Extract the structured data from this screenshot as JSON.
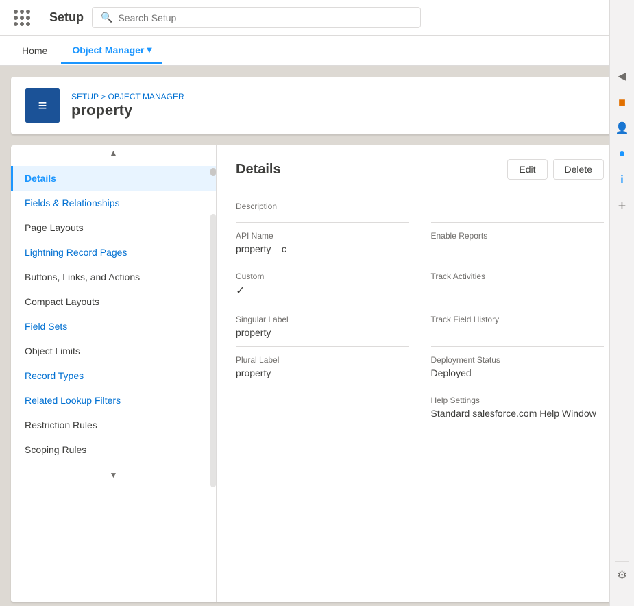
{
  "topBar": {
    "searchPlaceholder": "Search Setup"
  },
  "navBar": {
    "home": "Home",
    "objectManager": "Object Manager",
    "setupLabel": "Setup"
  },
  "breadcrumb": {
    "setup": "SETUP",
    "separator": " > ",
    "objectManager": "OBJECT MANAGER"
  },
  "objectHeader": {
    "title": "property",
    "iconLabel": "layers"
  },
  "leftNav": {
    "items": [
      {
        "id": "details",
        "label": "Details",
        "active": true,
        "link": false
      },
      {
        "id": "fields-relationships",
        "label": "Fields & Relationships",
        "active": false,
        "link": true
      },
      {
        "id": "page-layouts",
        "label": "Page Layouts",
        "active": false,
        "link": false
      },
      {
        "id": "lightning-record-pages",
        "label": "Lightning Record Pages",
        "active": false,
        "link": true
      },
      {
        "id": "buttons-links-actions",
        "label": "Buttons, Links, and Actions",
        "active": false,
        "link": false
      },
      {
        "id": "compact-layouts",
        "label": "Compact Layouts",
        "active": false,
        "link": false
      },
      {
        "id": "field-sets",
        "label": "Field Sets",
        "active": false,
        "link": true
      },
      {
        "id": "object-limits",
        "label": "Object Limits",
        "active": false,
        "link": false
      },
      {
        "id": "record-types",
        "label": "Record Types",
        "active": false,
        "link": true
      },
      {
        "id": "related-lookup-filters",
        "label": "Related Lookup Filters",
        "active": false,
        "link": true
      },
      {
        "id": "restriction-rules",
        "label": "Restriction Rules",
        "active": false,
        "link": false
      },
      {
        "id": "scoping-rules",
        "label": "Scoping Rules",
        "active": false,
        "link": false
      }
    ]
  },
  "detailPanel": {
    "title": "Details",
    "editLabel": "Edit",
    "deleteLabel": "Delete",
    "fields": [
      {
        "id": "description",
        "label": "Description",
        "value": "",
        "col": "left"
      },
      {
        "id": "api-name",
        "label": "API Name",
        "value": "property__c",
        "col": "left"
      },
      {
        "id": "enable-reports",
        "label": "Enable Reports",
        "value": "",
        "col": "right"
      },
      {
        "id": "custom",
        "label": "Custom",
        "value": "✓",
        "col": "left"
      },
      {
        "id": "track-activities",
        "label": "Track Activities",
        "value": "",
        "col": "right"
      },
      {
        "id": "singular-label",
        "label": "Singular Label",
        "value": "property",
        "col": "left"
      },
      {
        "id": "track-field-history",
        "label": "Track Field History",
        "value": "",
        "col": "right"
      },
      {
        "id": "plural-label",
        "label": "Plural Label",
        "value": "property",
        "col": "left"
      },
      {
        "id": "deployment-status",
        "label": "Deployment Status",
        "value": "Deployed",
        "col": "right"
      },
      {
        "id": "help-settings",
        "label": "Help Settings",
        "value": "Standard salesforce.com Help Window",
        "col": "right"
      }
    ]
  },
  "rightSidebar": {
    "icons": [
      "◀",
      "🧡",
      "👤",
      "🔵",
      "ℹ",
      "➕"
    ]
  }
}
